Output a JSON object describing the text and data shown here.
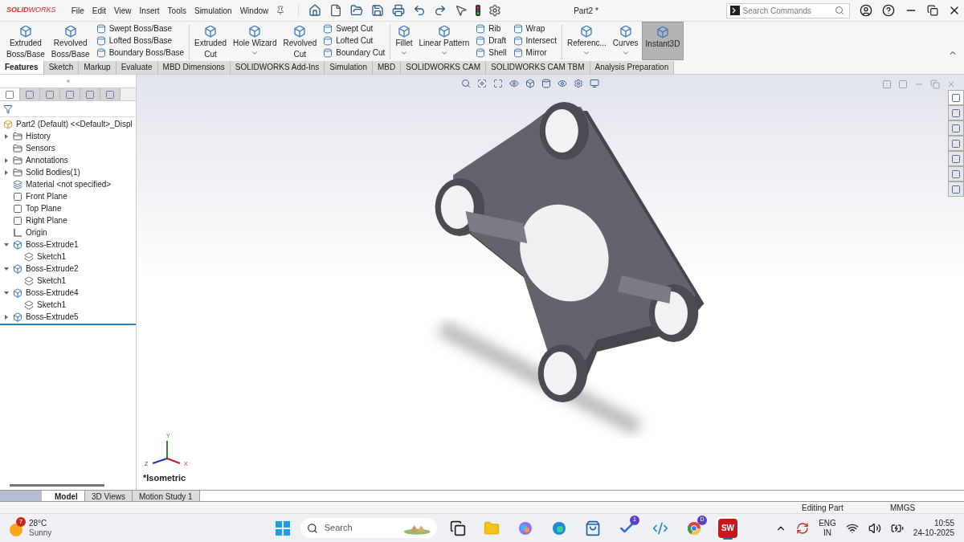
{
  "app": {
    "logo": "**SOLID**WORKS",
    "menu": [
      "File",
      "Edit",
      "View",
      "Insert",
      "Tools",
      "Simulation",
      "Window"
    ],
    "title": "Part2 *",
    "search": {
      "placeholder": "Search Commands"
    }
  },
  "ribbon": [
    {
      "kind": "large",
      "label": "Extruded\nBoss/Base",
      "dropdown": false,
      "selected": false
    },
    {
      "kind": "large",
      "label": "Revolved\nBoss/Base",
      "dropdown": false,
      "selected": false
    },
    {
      "kind": "stack",
      "items": [
        "Swept Boss/Base",
        "Lofted Boss/Base",
        "Boundary Boss/Base"
      ]
    },
    {
      "kind": "divider"
    },
    {
      "kind": "large",
      "label": "Extruded\nCut",
      "dropdown": false,
      "selected": false
    },
    {
      "kind": "large",
      "label": "Hole Wizard",
      "dropdown": true,
      "selected": false
    },
    {
      "kind": "large",
      "label": "Revolved\nCut",
      "dropdown": false,
      "selected": false
    },
    {
      "kind": "stack",
      "items": [
        "Swept Cut",
        "Lofted Cut",
        "Boundary Cut"
      ]
    },
    {
      "kind": "divider"
    },
    {
      "kind": "large",
      "label": "Fillet",
      "dropdown": true,
      "selected": false
    },
    {
      "kind": "large",
      "label": "Linear Pattern",
      "dropdown": true,
      "selected": false
    },
    {
      "kind": "stack",
      "items": [
        "Rib",
        "Draft",
        "Shell"
      ]
    },
    {
      "kind": "stack",
      "items": [
        "Wrap",
        "Intersect",
        "Mirror"
      ]
    },
    {
      "kind": "divider"
    },
    {
      "kind": "large",
      "label": "Referenc...",
      "dropdown": true,
      "selected": false
    },
    {
      "kind": "large",
      "label": "Curves",
      "dropdown": true,
      "selected": false
    },
    {
      "kind": "large",
      "label": "Instant3D",
      "dropdown": false,
      "selected": true
    }
  ],
  "tabs": [
    {
      "label": "Features",
      "selected": true
    },
    {
      "label": "Sketch",
      "selected": false
    },
    {
      "label": "Markup",
      "selected": false
    },
    {
      "label": "Evaluate",
      "selected": false
    },
    {
      "label": "MBD Dimensions",
      "selected": false
    },
    {
      "label": "SOLIDWORKS Add-Ins",
      "selected": false
    },
    {
      "label": "Simulation",
      "selected": false
    },
    {
      "label": "MBD",
      "selected": false
    },
    {
      "label": "SOLIDWORKS CAM",
      "selected": false
    },
    {
      "label": "SOLIDWORKS CAM TBM",
      "selected": false
    },
    {
      "label": "Analysis Preparation",
      "selected": false
    }
  ],
  "panel_tabs": [
    {
      "selected": true
    },
    {
      "selected": false
    },
    {
      "selected": false
    },
    {
      "selected": false
    },
    {
      "selected": false
    },
    {
      "selected": false
    }
  ],
  "tree": {
    "root": "Part2 (Default) <<Default>_Displ",
    "items": [
      {
        "kind": "folder",
        "label": "History",
        "expanded": false
      },
      {
        "kind": "folder",
        "label": "Sensors"
      },
      {
        "kind": "folder",
        "label": "Annotations",
        "expanded": false
      },
      {
        "kind": "folder",
        "label": "Solid Bodies(1)",
        "expanded": false
      },
      {
        "kind": "material",
        "label": "Material <not specified>"
      },
      {
        "kind": "plane",
        "label": "Front Plane"
      },
      {
        "kind": "plane",
        "label": "Top Plane"
      },
      {
        "kind": "plane",
        "label": "Right Plane"
      },
      {
        "kind": "origin",
        "label": "Origin"
      },
      {
        "kind": "feature",
        "label": "Boss-Extrude1",
        "expanded": true,
        "children": [
          {
            "kind": "sketch",
            "label": "Sketch1"
          }
        ]
      },
      {
        "kind": "feature",
        "label": "Boss-Extrude2",
        "expanded": true,
        "children": [
          {
            "kind": "sketch",
            "label": "Sketch1"
          }
        ]
      },
      {
        "kind": "feature",
        "label": "Boss-Extrude4",
        "expanded": true,
        "children": [
          {
            "kind": "sketch",
            "label": "Sketch1"
          }
        ]
      },
      {
        "kind": "feature",
        "label": "Boss-Extrude5",
        "expanded": false
      }
    ]
  },
  "viewport": {
    "view": "*Isometric",
    "triad": {
      "x": "X",
      "y": "Y",
      "z": "Z"
    }
  },
  "task_pane": [
    {
      "selected": true
    },
    {
      "selected": false
    },
    {
      "selected": false
    },
    {
      "selected": false
    },
    {
      "selected": false
    },
    {
      "selected": false
    },
    {
      "selected": false
    }
  ],
  "bottom_tabs": [
    {
      "label": "Model",
      "selected": true
    },
    {
      "label": "3D Views",
      "selected": false
    },
    {
      "label": "Motion Study 1",
      "selected": false
    }
  ],
  "status_bar": {
    "mode": "Editing Part",
    "units": "MMGS"
  },
  "taskbar": {
    "weather": {
      "badge": "7",
      "temp": "28°C",
      "desc": "Sunny"
    },
    "search": {
      "placeholder": "Search"
    },
    "apps": [
      {
        "kind": "task-view",
        "active": false
      },
      {
        "kind": "explorer",
        "active": false
      },
      {
        "kind": "copilot",
        "active": false
      },
      {
        "kind": "edge",
        "active": false
      },
      {
        "kind": "store",
        "active": false
      },
      {
        "kind": "todo",
        "badge": "1",
        "active": false
      },
      {
        "kind": "vscode",
        "active": false
      },
      {
        "kind": "chrome",
        "badge": "D",
        "active": false
      },
      {
        "kind": "solidworks",
        "label": "SW",
        "active": true
      }
    ],
    "lang": "ENG",
    "region": "IN",
    "time": "10:55",
    "date": "24-10-2025"
  }
}
